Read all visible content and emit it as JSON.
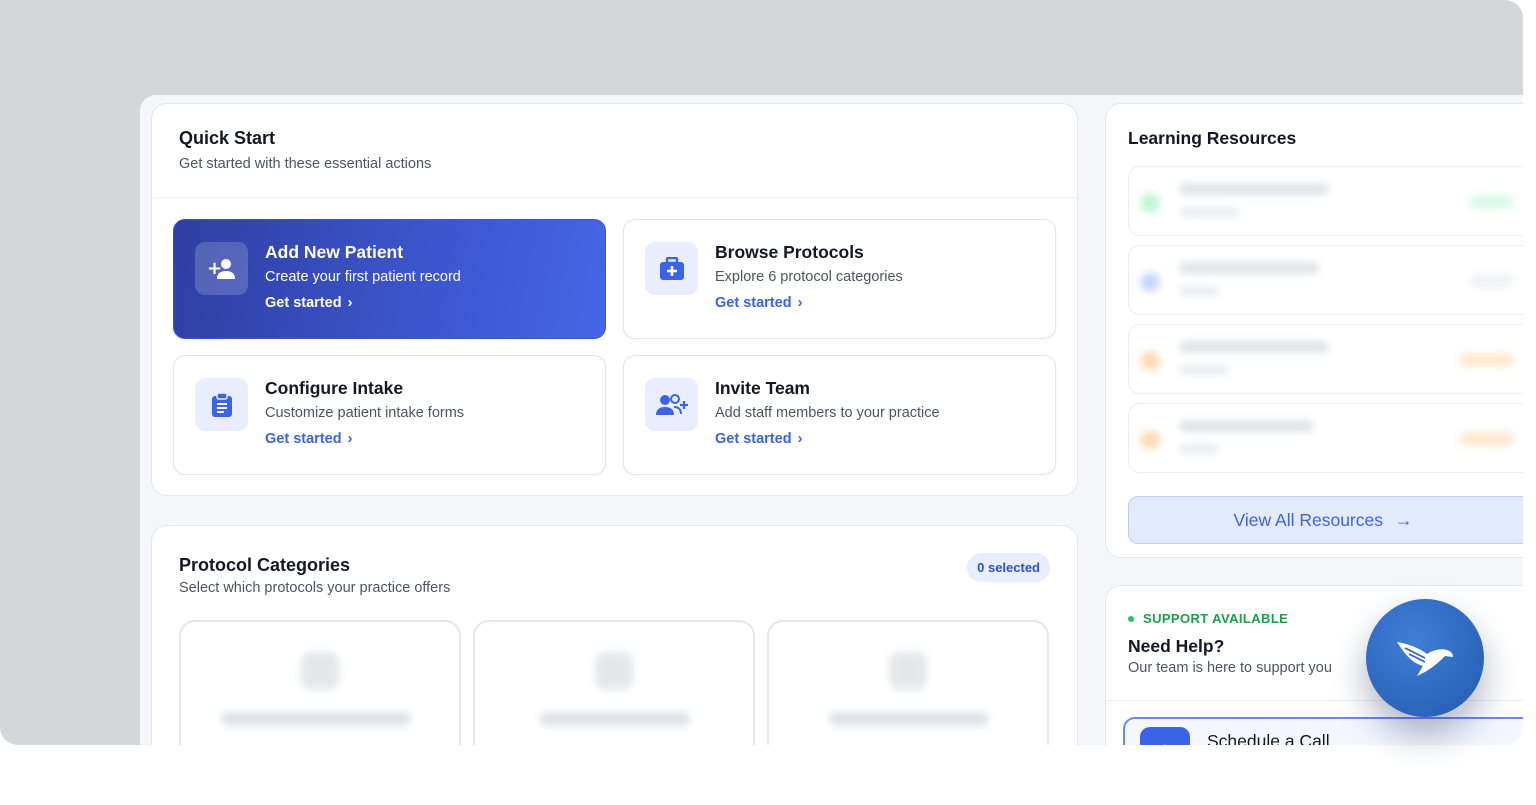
{
  "quick_start": {
    "title": "Quick Start",
    "subtitle": "Get started with these essential actions",
    "actions": [
      {
        "title": "Add New Patient",
        "desc": "Create your first patient record",
        "link": "Get started",
        "icon": "add-user-icon"
      },
      {
        "title": "Browse Protocols",
        "desc": "Explore 6 protocol categories",
        "link": "Get started",
        "icon": "medical-kit-icon"
      },
      {
        "title": "Configure Intake",
        "desc": "Customize patient intake forms",
        "link": "Get started",
        "icon": "clipboard-icon"
      },
      {
        "title": "Invite Team",
        "desc": "Add staff members to your practice",
        "link": "Get started",
        "icon": "team-add-icon"
      }
    ]
  },
  "protocols": {
    "title": "Protocol Categories",
    "subtitle": "Select which protocols your practice offers",
    "badge": "0 selected"
  },
  "learning": {
    "title": "Learning Resources",
    "view_all": "View All Resources"
  },
  "help": {
    "status": "SUPPORT AVAILABLE",
    "title": "Need Help?",
    "subtitle": "Our team is here to support you",
    "schedule": "Schedule a Call"
  },
  "colors": {
    "accent": "#3b63e6",
    "primary_gradient_start": "#2f3fa3",
    "primary_gradient_end": "#4566e9",
    "support_green": "#16a34a",
    "fab": "#2d67c2"
  }
}
